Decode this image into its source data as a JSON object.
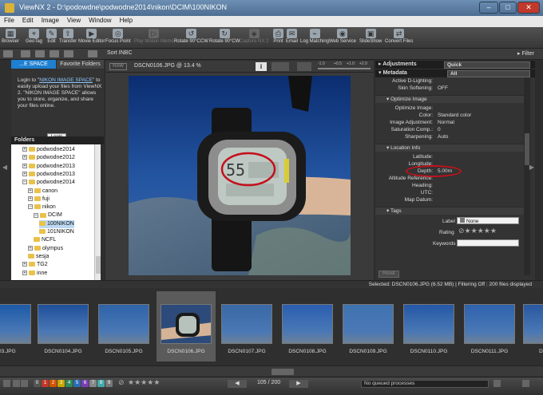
{
  "window": {
    "title": "ViewNX 2 - D:\\podowdne\\podwodne2014\\nikon\\DCIM\\100NIKON",
    "min": "–",
    "max": "□",
    "close": "✕"
  },
  "menu": [
    "File",
    "Edit",
    "Image",
    "View",
    "Window",
    "Help"
  ],
  "toolbar": [
    {
      "label": "Browser",
      "icon": "browser-icon",
      "enabled": true
    },
    {
      "label": "GeoTag",
      "icon": "geotag-icon",
      "enabled": true
    },
    {
      "label": "Edit",
      "icon": "edit-icon",
      "enabled": true
    },
    {
      "label": "Transfer",
      "icon": "transfer-icon",
      "enabled": true
    },
    {
      "label": "Movie Editor",
      "icon": "movie-editor-icon",
      "enabled": true
    },
    {
      "label": "Focus Point",
      "icon": "focus-point-icon",
      "enabled": true
    },
    {
      "label": "Play Motion Memo",
      "icon": "play-motion-memo-icon",
      "enabled": false
    },
    {
      "label": "Rotate 90°CCW",
      "icon": "rotate-ccw-icon",
      "enabled": true
    },
    {
      "label": "Rotate 90°CW",
      "icon": "rotate-cw-icon",
      "enabled": true
    },
    {
      "label": "Capture NX 2",
      "icon": "capture-nx2-icon",
      "enabled": false
    },
    {
      "label": "Print",
      "icon": "print-icon",
      "enabled": true
    },
    {
      "label": "Email",
      "icon": "email-icon",
      "enabled": true
    },
    {
      "label": "Log Matching",
      "icon": "log-matching-icon",
      "enabled": true
    },
    {
      "label": "Web Service",
      "icon": "web-service-icon",
      "enabled": true
    },
    {
      "label": "SlideShow",
      "icon": "slideshow-icon",
      "enabled": true
    },
    {
      "label": "Convert Files",
      "icon": "convert-files-icon",
      "enabled": true
    }
  ],
  "subbar": {
    "sort": "Sort",
    "sort_value": "INBC",
    "filter": "Filter"
  },
  "left": {
    "tab_active": "...E SPACE",
    "tab_other": "Favorite Folders",
    "message_pre": "Login to \"",
    "message_link": "NIKON IMAGE SPACE",
    "message_post": "\" to easily upload your files from ViewNX 2. \"NIKON IMAGE SPACE\" allows you to store, organize, and share your files online.",
    "login": "Login",
    "folders_header": "Folders",
    "tree": [
      {
        "label": "podwodne2014",
        "indent": 2,
        "exp": "+"
      },
      {
        "label": "podwodne2012",
        "indent": 2,
        "exp": "+"
      },
      {
        "label": "podwodne2013",
        "indent": 2,
        "exp": "+"
      },
      {
        "label": "podwodne2013",
        "indent": 2,
        "exp": "+"
      },
      {
        "label": "podwodne2014",
        "indent": 2,
        "exp": "–"
      },
      {
        "label": "canon",
        "indent": 3,
        "exp": "+"
      },
      {
        "label": "fuji",
        "indent": 3,
        "exp": "+"
      },
      {
        "label": "nikon",
        "indent": 3,
        "exp": "–"
      },
      {
        "label": "DCIM",
        "indent": 4,
        "exp": "–"
      },
      {
        "label": "100NIKON",
        "indent": 5,
        "exp": "",
        "sel": true
      },
      {
        "label": "101NIKON",
        "indent": 5,
        "exp": ""
      },
      {
        "label": "NCFL",
        "indent": 4,
        "exp": ""
      },
      {
        "label": "olympus",
        "indent": 3,
        "exp": "+"
      },
      {
        "label": "sesja",
        "indent": 3,
        "exp": ""
      },
      {
        "label": "TG2",
        "indent": 2,
        "exp": "+"
      },
      {
        "label": "inne",
        "indent": 2,
        "exp": "+"
      }
    ]
  },
  "viewer": {
    "raw_badge": "RAW",
    "filename": "DSCN0106.JPG @ 13.4 %",
    "info_btn": "i",
    "zoom_values": [
      "-1.0",
      "+0.5",
      "+1.0",
      "+2.0"
    ],
    "lcd_depth": "55"
  },
  "right": {
    "adjustments": "Adjustments",
    "adjustments_value": "Quick",
    "metadata": "Metadata",
    "metadata_value": "All",
    "rows_top": [
      {
        "k": "Active D-Lighting:",
        "v": ""
      },
      {
        "k": "Skin Softening:",
        "v": "OFF"
      }
    ],
    "optimize_header": "Optimize Image",
    "optimize": [
      {
        "k": "Optimize Image:",
        "v": ""
      },
      {
        "k": "Color:",
        "v": "Standard color"
      },
      {
        "k": "Image Adjustment:",
        "v": "Normal"
      },
      {
        "k": "Saturation Comp.:",
        "v": "0"
      },
      {
        "k": "Sharpening:",
        "v": "Auto"
      }
    ],
    "location_header": "Location Info",
    "location": [
      {
        "k": "Latitude:",
        "v": ""
      },
      {
        "k": "Longitude:",
        "v": ""
      },
      {
        "k": "Depth:",
        "v": "5.00m"
      },
      {
        "k": "Altitude Reference:",
        "v": ""
      },
      {
        "k": "Heading:",
        "v": ""
      },
      {
        "k": "UTC:",
        "v": ""
      },
      {
        "k": "Map Datum:",
        "v": ""
      }
    ],
    "tags_header": "Tags",
    "label": "Label",
    "label_value": "None",
    "rating": "Rating",
    "keywords": "Keywords",
    "reset": "Reset"
  },
  "status": "Selected: DSCN0106.JPG (6.52 MB) | Filtering Off : 200 files displayed",
  "film": [
    {
      "cap": "..03.JPG",
      "tone": "#1d5aa8",
      "sel": false
    },
    {
      "cap": "DSCN0104.JPG",
      "tone": "#1f4f9a",
      "sel": false
    },
    {
      "cap": "DSCN0105.JPG",
      "tone": "#2e63a8",
      "sel": false
    },
    {
      "cap": "DSCN0106.JPG",
      "tone": "#283f6a",
      "sel": true
    },
    {
      "cap": "DSCN0107.JPG",
      "tone": "#3868a5",
      "sel": false
    },
    {
      "cap": "DSCN0108.JPG",
      "tone": "#2a5db0",
      "sel": false
    },
    {
      "cap": "DSCN0109.JPG",
      "tone": "#3f73b0",
      "sel": false
    },
    {
      "cap": "DSCN0110.JPG",
      "tone": "#2458a6",
      "sel": false
    },
    {
      "cap": "DSCN0111.JPG",
      "tone": "#2e62ad",
      "sel": false
    },
    {
      "cap": "DSCN...",
      "tone": "#2958a0",
      "sel": false
    }
  ],
  "bottom": {
    "labels": [
      "0",
      "1",
      "2",
      "3",
      "4",
      "5",
      "6",
      "7",
      "8",
      "9"
    ],
    "label_colors": [
      "#555",
      "#c0392b",
      "#d35400",
      "#c9a500",
      "#2e8b57",
      "#2e6db5",
      "#7a3fb5",
      "#888",
      "#4aa",
      "#777"
    ],
    "page": "105 / 200",
    "queue": "No queued processes"
  }
}
